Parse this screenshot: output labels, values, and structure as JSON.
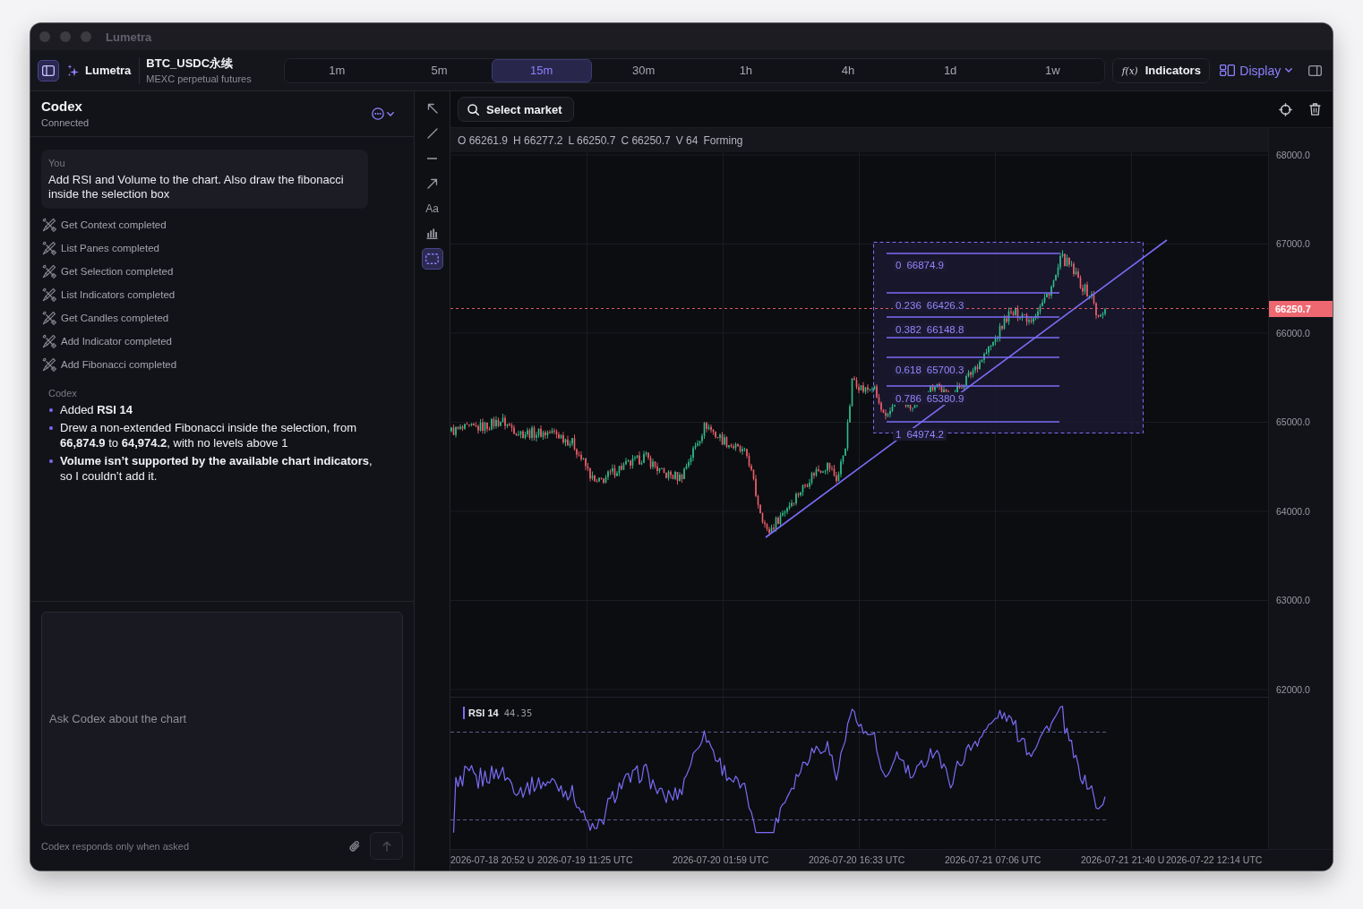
{
  "window": {
    "title": "Lumetra"
  },
  "toolbar": {
    "app_name": "Lumetra",
    "market": {
      "symbol": "BTC_USDC永续",
      "exchange": "MEXC perpetual futures"
    },
    "timeframes": [
      {
        "label": "1m",
        "selected": false
      },
      {
        "label": "5m",
        "selected": false
      },
      {
        "label": "15m",
        "selected": true
      },
      {
        "label": "30m",
        "selected": false
      },
      {
        "label": "1h",
        "selected": false
      },
      {
        "label": "4h",
        "selected": false
      },
      {
        "label": "1d",
        "selected": false
      },
      {
        "label": "1w",
        "selected": false
      }
    ],
    "indicators_button": {
      "icon": "f(x)",
      "label": "Indicators"
    },
    "display_button": {
      "label": "Display"
    }
  },
  "assistant_panel": {
    "title": "Codex",
    "status": "Connected",
    "messages": [
      {
        "kind": "user",
        "author": "You",
        "text": "Add RSI and Volume to the chart. Also draw the fibonacci inside the selection box"
      },
      {
        "kind": "tools",
        "steps": [
          "Get Context completed",
          "List Panes completed",
          "Get Selection completed",
          "List Indicators completed",
          "Get Candles completed",
          "Add Indicator completed",
          "Add Fibonacci completed"
        ]
      },
      {
        "kind": "assistant",
        "author": "Codex",
        "bullets": [
          "Added **RSI 14**",
          "Drew a non-extended Fibonacci inside the selection, from **66,874.9** to **64,974.2**, with no levels above 1",
          "**Volume isn’t supported by the available chart indicators**, so I couldn’t add it."
        ]
      }
    ],
    "composer": {
      "placeholder": "Ask Codex about the chart",
      "note": "Codex responds only when asked",
      "send_button": {
        "disabled": true
      }
    }
  },
  "drawing_tools": [
    {
      "kind": "cursor",
      "selected": false
    },
    {
      "kind": "trendline",
      "selected": false
    },
    {
      "kind": "hline",
      "selected": false
    },
    {
      "kind": "arrow",
      "selected": false
    },
    {
      "kind": "text",
      "label": "Aa",
      "selected": false
    },
    {
      "kind": "indicators",
      "selected": false
    },
    {
      "kind": "selection",
      "selected": true
    }
  ],
  "chart": {
    "market_button": {
      "label": "Select market"
    },
    "ohlc": [
      "O 66261.9",
      "H 66277.2",
      "L 66250.7",
      "C 66250.7",
      "V 64"
    ],
    "candle_status": "Forming",
    "price_axis": [
      "68000.0",
      "67000.0",
      "66000.0",
      "65000.0",
      "64000.0",
      "63000.0",
      "62000.0"
    ],
    "last_price": "66250.7",
    "fibonacci": [
      {
        "ratio": "0",
        "price": "66874.9"
      },
      {
        "ratio": "0.236",
        "price": "66426.3"
      },
      {
        "ratio": "0.382",
        "price": "66148.8"
      },
      {
        "ratio": "0.618",
        "price": "65700.3"
      },
      {
        "ratio": "0.786",
        "price": "65380.9"
      },
      {
        "ratio": "1",
        "price": "64974.2"
      }
    ],
    "rsi": {
      "name": "RSI 14",
      "value": "44.35"
    },
    "time_axis": [
      "2026-07-18 20:52 U",
      "2026-07-19 11:25 UTC",
      "2026-07-20 01:59 UTC",
      "2026-07-20 16:33 UTC",
      "2026-07-21 07:06 UTC",
      "2026-07-21 21:40 U",
      "2026-07-22 12:14 UTC"
    ]
  }
}
